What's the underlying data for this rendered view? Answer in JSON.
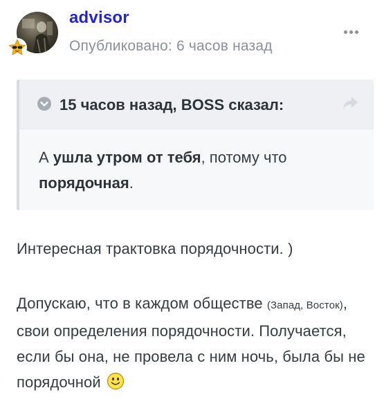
{
  "post": {
    "author": "advisor",
    "published": "Опубликовано: 6 часов назад",
    "badge_icon": "sunglasses-star-icon",
    "more_icon": "more-options-icon"
  },
  "quote": {
    "citation": "15 часов назад, BOSS сказал:",
    "text_prefix": "А ",
    "text_bold1": "ушла утром от тебя",
    "text_mid": ", потому что ",
    "text_bold2": "порядочная",
    "text_suffix": "."
  },
  "comment": {
    "paragraph1": "Интересная трактовка порядочности. )",
    "p2_start": "Допускаю, что в каждом обществе ",
    "p2_small": "(Запад, Восток)",
    "p2_end": ", свои определения порядочности. Получается, если бы она, не провела с ним ночь, была бы не порядочной ",
    "emoji": "smiley-icon"
  },
  "colors": {
    "author": "#2323d6",
    "meta": "#8a9099",
    "text": "#353c41",
    "quote_bg": "#f7f8fa",
    "quote_head_bg": "#eef0f4"
  }
}
